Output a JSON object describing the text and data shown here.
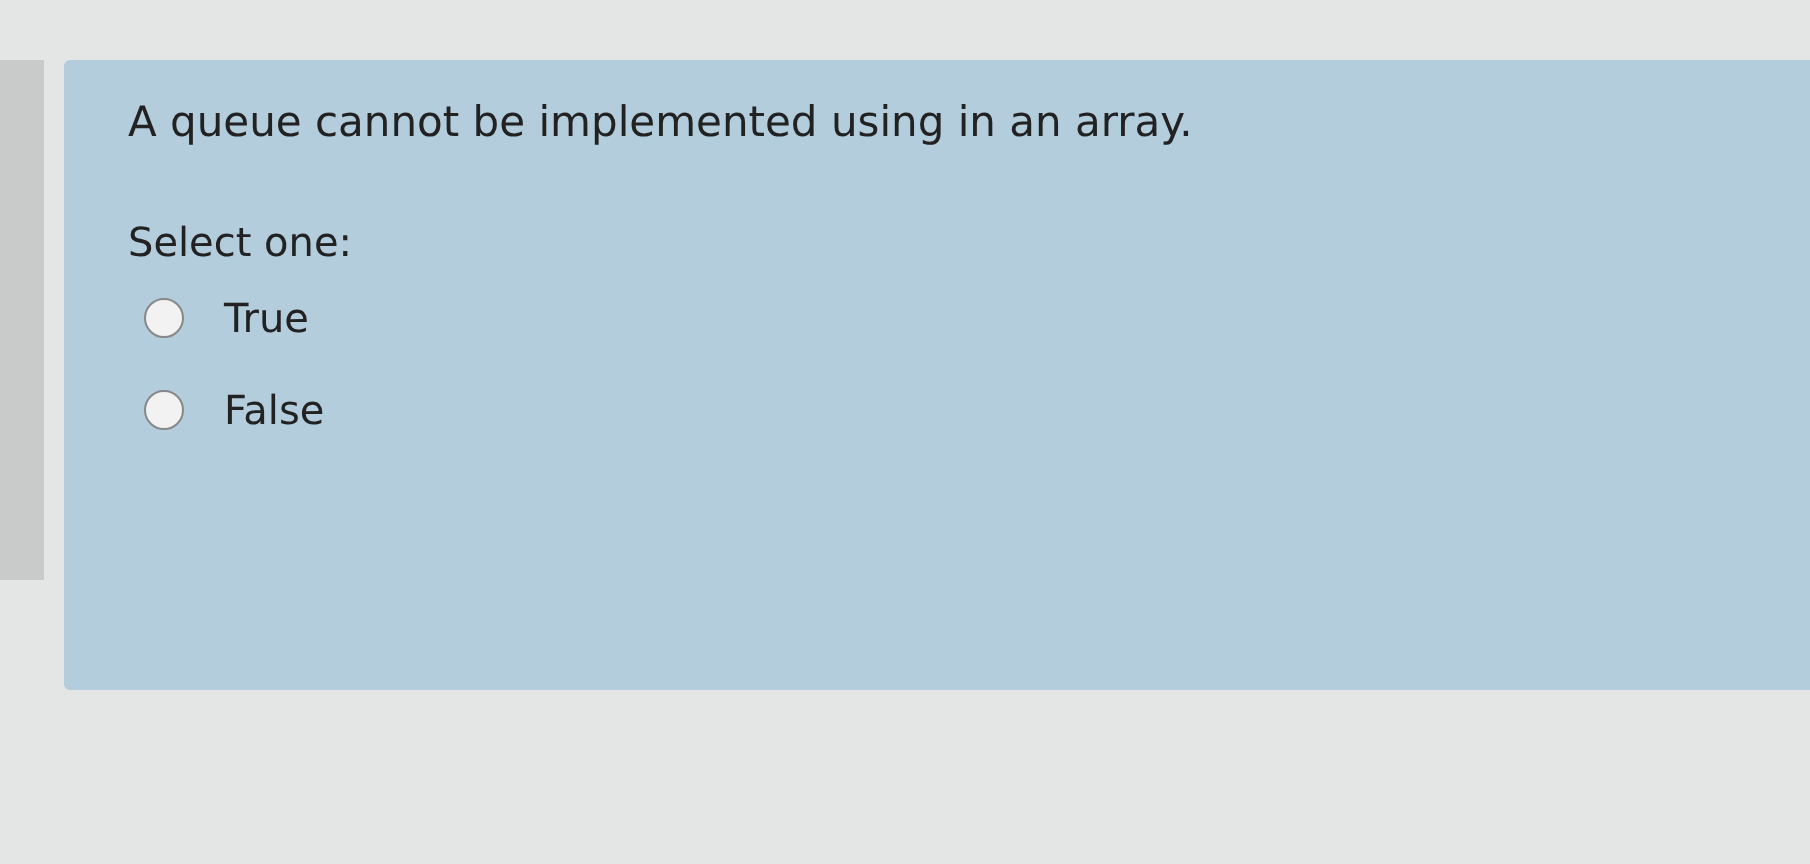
{
  "question": {
    "text": "A queue cannot be implemented using in an array.",
    "prompt": "Select one:",
    "options": [
      {
        "label": "True",
        "selected": false
      },
      {
        "label": "False",
        "selected": false
      }
    ]
  }
}
